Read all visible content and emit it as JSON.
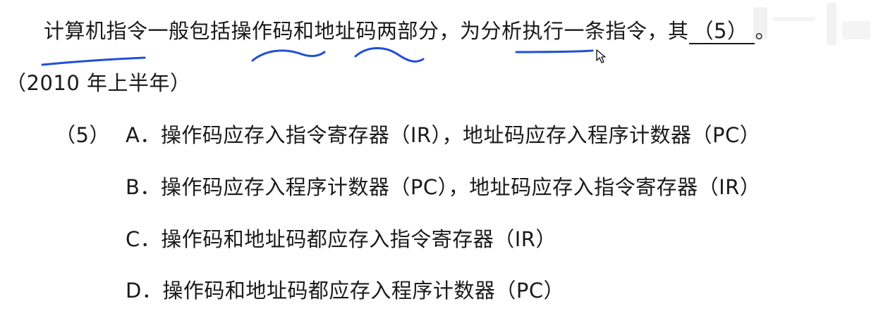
{
  "question": {
    "text": "计算机指令一般包括操作码和地址码两部分，为分析执行一条指令，其",
    "blank_label": "（5）",
    "end_punct": "。",
    "source": "（2010 年上半年）"
  },
  "options": {
    "number": "（5）",
    "a": "A．操作码应存入指令寄存器（IR），地址码应存入程序计数器（PC）",
    "b": "B．操作码应存入程序计数器（PC），地址码应存入指令寄存器（IR）",
    "c": "C．操作码和地址码都应存入指令寄存器（IR）",
    "d": "D．操作码和地址码都应存入程序计数器（PC）"
  },
  "colors": {
    "text": "#1a1a1a",
    "annotation": "#1f4fd6"
  },
  "icons": {
    "cursor": "mouse-pointer-icon",
    "watermark": "logo-watermark-icon"
  }
}
